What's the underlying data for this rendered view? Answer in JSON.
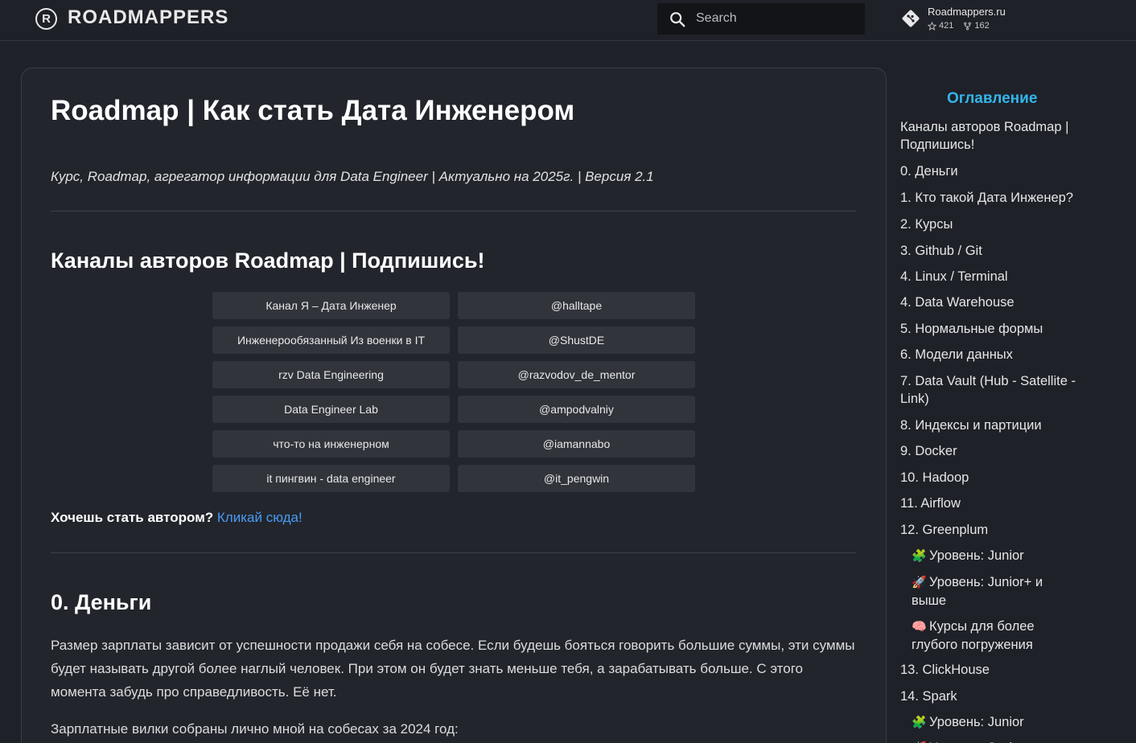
{
  "header": {
    "logo_glyph": "R",
    "logo_text": "ROADMAPPERS",
    "search_placeholder": "Search",
    "repo": {
      "name": "Roadmappers.ru",
      "stars": "421",
      "forks": "162"
    }
  },
  "article": {
    "title": "Roadmap | Как стать Дата Инженером",
    "subtitle": "Курс, Roadmap, агрегатор информации для Data Engineer | Актуально на 2025г. | Версия 2.1",
    "channels_heading": "Каналы авторов Roadmap | Подпишись!",
    "channels": [
      {
        "name": "Канал Я – Дата Инженер",
        "handle": "@halltape"
      },
      {
        "name": "Инженерообязанный Из военки в IT",
        "handle": "@ShustDE"
      },
      {
        "name": "rzv Data Engineering",
        "handle": "@razvodov_de_mentor"
      },
      {
        "name": "Data Engineer Lab",
        "handle": "@ampodvalniy"
      },
      {
        "name": "что-то на инженерном",
        "handle": "@iamannabo"
      },
      {
        "name": "it пингвин - data engineer",
        "handle": "@it_pengwin"
      }
    ],
    "author_prompt": "Хочешь стать автором?",
    "author_link": "Кликай сюда!",
    "money_heading": "0. Деньги",
    "money_para": "Размер зарплаты зависит от успешности продажи себя на собесе. Если будешь бояться говорить большие суммы, эти суммы будет называть другой более наглый человек. При этом он будет знать меньше тебя, а зарабатывать больше. С этого момента забудь про справедливость. Её нет.",
    "salary_para": "Зарплатные вилки собраны лично мной на собесах за 2024 год:"
  },
  "toc": {
    "title": "Оглавление",
    "items": [
      {
        "label": "Каналы авторов Roadmap | Подпишись!"
      },
      {
        "label": "0. Деньги"
      },
      {
        "label": "1. Кто такой Дата Инженер?"
      },
      {
        "label": "2. Курсы"
      },
      {
        "label": "3. Github / Git"
      },
      {
        "label": "4. Linux / Terminal"
      },
      {
        "label": "4. Data Warehouse"
      },
      {
        "label": "5. Нормальные формы"
      },
      {
        "label": "6. Модели данных"
      },
      {
        "label": "7. Data Vault (Hub - Satellite - Link)"
      },
      {
        "label": "8. Индексы и партиции"
      },
      {
        "label": "9. Docker"
      },
      {
        "label": "10. Hadoop"
      },
      {
        "label": "11. Airflow"
      },
      {
        "label": "12. Greenplum"
      },
      {
        "label": "Уровень: Junior",
        "emoji": "🧩"
      },
      {
        "label": "Уровень: Junior+ и выше",
        "emoji": "🚀"
      },
      {
        "label": "Курсы для более глубого погружения",
        "emoji": "🧠"
      },
      {
        "label": "13. ClickHouse"
      },
      {
        "label": "14. Spark"
      },
      {
        "label": "Уровень: Junior",
        "emoji": "🧩"
      },
      {
        "label": "Уровень: Junior+ и выше",
        "emoji": "🚀"
      }
    ]
  },
  "colors": {
    "background": "#1e2128",
    "card": "#22252c",
    "accent_link": "#4a9bf5",
    "toc_title": "#33b6ec",
    "button": "#31343b"
  }
}
